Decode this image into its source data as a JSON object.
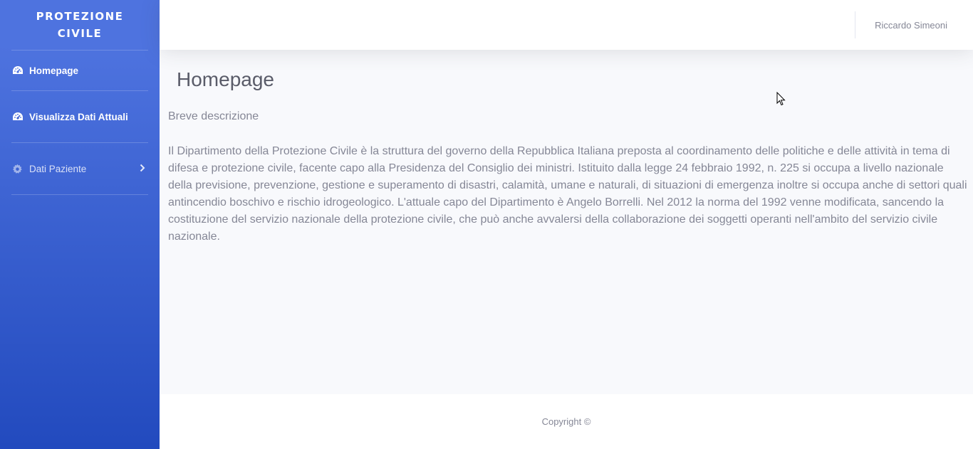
{
  "sidebar": {
    "brand_line1": "PROTEZIONE",
    "brand_line2": "CIVILE",
    "items": [
      {
        "label": "Homepage",
        "icon": "tachometer-icon"
      },
      {
        "label": "Visualizza Dati Attuali",
        "icon": "tachometer-icon"
      },
      {
        "label": "Dati Paziente",
        "icon": "gear-icon"
      }
    ]
  },
  "topbar": {
    "user_name": "Riccardo Simeoni"
  },
  "main": {
    "title": "Homepage",
    "description_title": "Breve descrizione",
    "description_body": "Il Dipartimento della Protezione Civile è la struttura del governo della Repubblica Italiana preposta al coordinamento delle politiche e delle attività in tema di difesa e protezione civile, facente capo alla Presidenza del Consiglio dei ministri. Istituito dalla legge 24 febbraio 1992, n. 225 si occupa a livello nazionale della previsione, prevenzione, gestione e superamento di disastri, calamità, umane e naturali, di situazioni di emergenza inoltre si occupa anche di settori quali antincendio boschivo e rischio idrogeologico. L'attuale capo del Dipartimento è Angelo Borrelli. Nel 2012 la norma del 1992 venne modificata, sancendo la costituzione del servizio nazionale della protezione civile, che può anche avvalersi della collaborazione dei soggetti operanti nell'ambito del servizio civile nazionale."
  },
  "footer": {
    "copyright": "Copyright ©"
  },
  "colors": {
    "sidebar_top": "#4e73df",
    "sidebar_bottom": "#224abe",
    "text_muted": "#858796",
    "heading": "#5a5c69",
    "page_bg": "#f8f9fc"
  }
}
